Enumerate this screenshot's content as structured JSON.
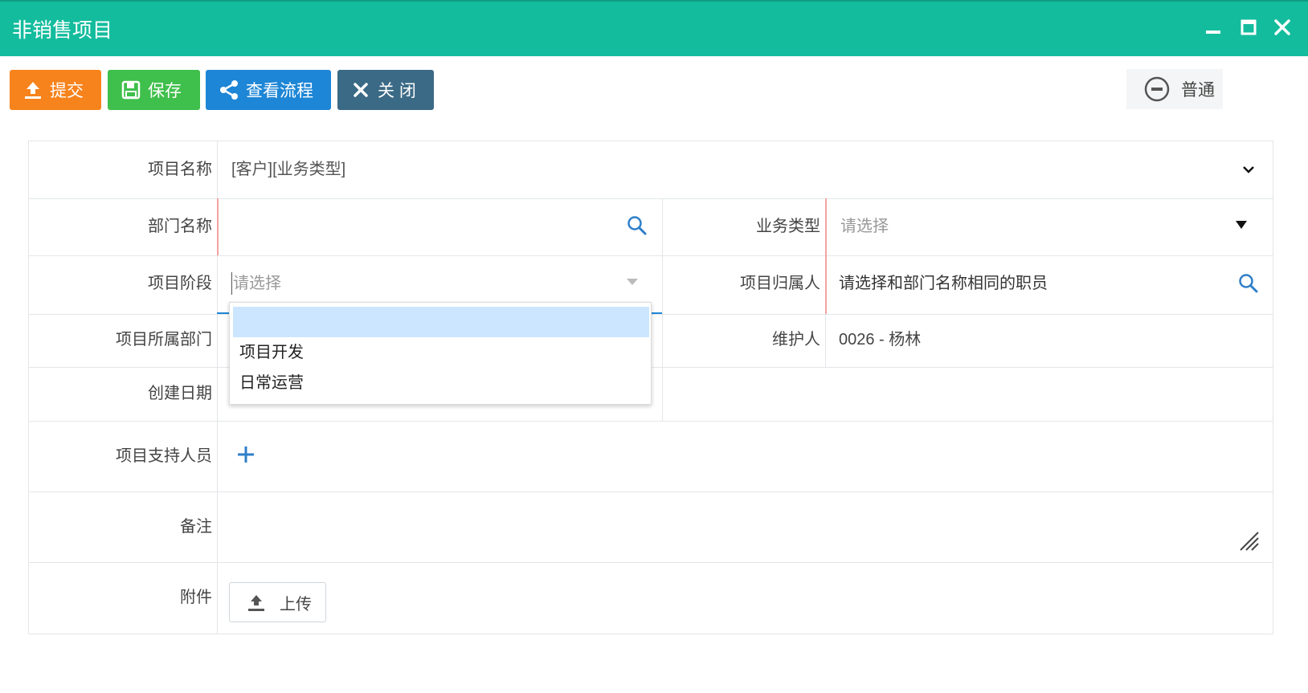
{
  "window": {
    "title": "非销售项目"
  },
  "toolbar": {
    "submit_label": "提交",
    "save_label": "保存",
    "flow_label": "查看流程",
    "close_label": "关 闭",
    "priority_label": "普通",
    "colors": {
      "submit": "#f7831c",
      "save": "#3fbf4b",
      "flow": "#1e86d6",
      "close": "#3b6a86",
      "titlebar": "#13bc9d"
    }
  },
  "form": {
    "project_name": {
      "label": "项目名称",
      "value": "[客户][业务类型]"
    },
    "department": {
      "label": "部门名称",
      "value": ""
    },
    "business_type": {
      "label": "业务类型",
      "placeholder": "请选择"
    },
    "project_stage": {
      "label": "项目阶段",
      "placeholder": "请选择"
    },
    "project_owner": {
      "label": "项目归属人",
      "placeholder": "请选择和部门名称相同的职员"
    },
    "project_department": {
      "label": "项目所属部门",
      "value": ""
    },
    "maintainer": {
      "label": "维护人",
      "value": "0026 - 杨林"
    },
    "create_date": {
      "label": "创建日期",
      "value": ""
    },
    "support_staff": {
      "label": "项目支持人员"
    },
    "remarks": {
      "label": "备注",
      "value": ""
    },
    "attachment": {
      "label": "附件",
      "upload_label": "上传"
    }
  },
  "stage_dropdown": {
    "options": [
      "",
      "项目开发",
      "日常运营"
    ]
  }
}
